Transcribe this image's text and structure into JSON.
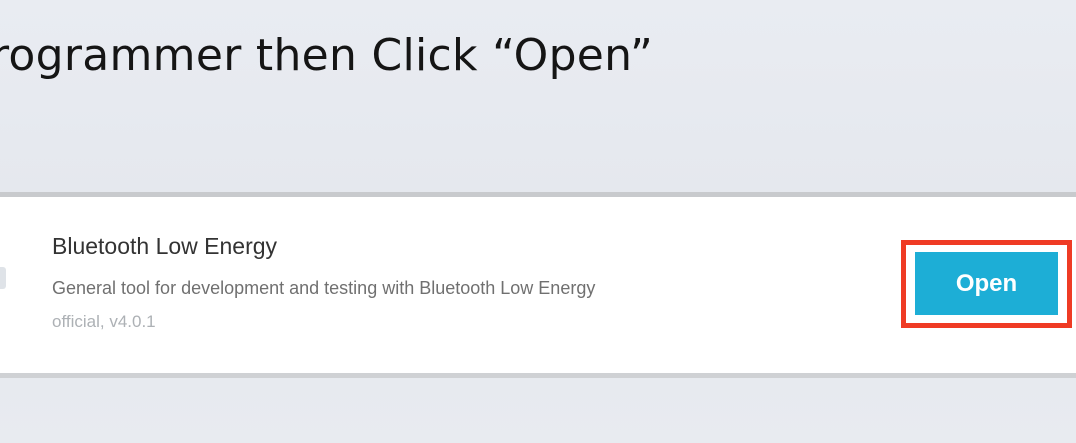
{
  "instruction": {
    "heading": "rogrammer then Click “Open”"
  },
  "app_card": {
    "name": "Bluetooth Low Energy",
    "description": "General tool for development and testing with Bluetooth Low Energy",
    "meta": "official, v4.0.1",
    "open_label": "Open"
  },
  "colors": {
    "background": "#e6e9ef",
    "card": "#ffffff",
    "button": "#1daed6",
    "highlight": "#ef3b24"
  }
}
